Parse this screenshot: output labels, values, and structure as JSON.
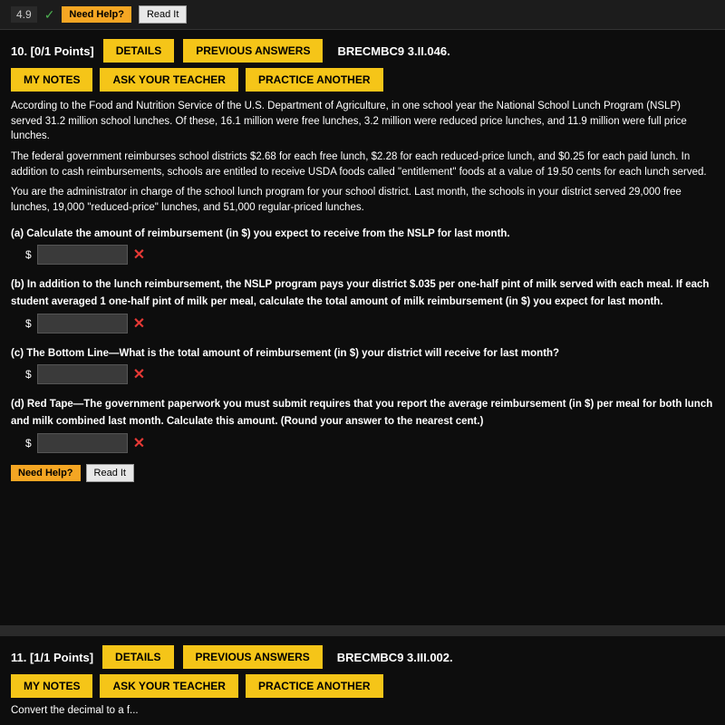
{
  "top_strip": {
    "score": "4.9",
    "check": "✓",
    "need_help_label": "Need Help?",
    "read_it_label": "Read It"
  },
  "question10": {
    "points": "10. [0/1 Points]",
    "details_label": "DETAILS",
    "prev_answers_label": "PREVIOUS ANSWERS",
    "code": "BRECMBC9 3.II.046.",
    "my_notes_label": "MY NOTES",
    "ask_teacher_label": "ASK YOUR TEACHER",
    "practice_label": "PRACTICE ANOTHER",
    "body_p1": "According to the Food and Nutrition Service of the U.S. Department of Agriculture, in one school year the National School Lunch Program (NSLP) served 31.2 million school lunches. Of these, 16.1 million were free lunches, 3.2 million were reduced price lunches, and 11.9 million were full price lunches.",
    "body_p2": "The federal government reimburses school districts $2.68 for each free lunch, $2.28 for each reduced-price lunch, and $0.25 for each paid lunch. In addition to cash reimbursements, schools are entitled to receive USDA foods called \"entitlement\" foods at a value of 19.50 cents for each lunch served.",
    "body_p3": "You are the administrator in charge of the school lunch program for your school district. Last month, the schools in your district served 29,000 free lunches, 19,000 \"reduced-price\" lunches, and 51,000 regular-priced lunches.",
    "sub_a": "(a)   Calculate the amount of reimbursement (in $) you expect to receive from the NSLP for last month.",
    "sub_b": "(b)   In addition to the lunch reimbursement, the NSLP program pays your district $.035 per one-half pint of milk served with each meal. If each student averaged 1 one-half pint of milk per meal, calculate the total amount of milk reimbursement (in $) you expect for last month.",
    "sub_c": "(c)   The Bottom Line—What is the total amount of reimbursement (in $) your district will receive for last month?",
    "sub_d": "(d)   Red Tape—The government paperwork you must submit requires that you report the average reimbursement (in $) per meal for both lunch and milk combined last month. Calculate this amount. (Round your answer to the nearest cent.)",
    "need_help_label": "Need Help?",
    "read_it_label": "Read It"
  },
  "question11": {
    "points": "11. [1/1 Points]",
    "details_label": "DETAILS",
    "prev_answers_label": "PREVIOUS ANSWERS",
    "code": "BRECMBC9 3.III.002.",
    "my_notes_label": "MY NOTES",
    "ask_teacher_label": "ASK YOUR TEACHER",
    "practice_label": "PRACTICE ANOTHER",
    "convert_text": "Convert the decimal to a f..."
  }
}
